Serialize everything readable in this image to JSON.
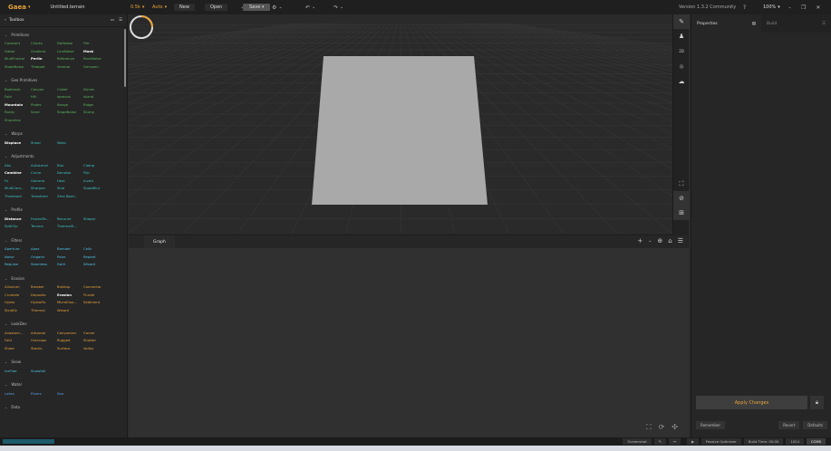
{
  "titlebar": {
    "app_name": "Gaea",
    "file_name": "Untitled.terrain",
    "resolution": "0.5k",
    "mode": "Auto",
    "new_label": "New",
    "open_label": "Open",
    "save_label": "Save",
    "version": "Version 1.3.2 Community",
    "zoom": "100%"
  },
  "toolbox": {
    "title": "Toolbox",
    "categories": [
      {
        "name": "Primitives",
        "color": "green",
        "items": [
          "Constant",
          "Cracks",
          "DotNoise",
          "File",
          "Gabor",
          "Gradient",
          "LineNoise",
          "Mask",
          "MultiFractal",
          "Perlin",
          "Reference",
          "RockNoise",
          "SlopeNoise",
          "Thebpet",
          "Voronoi",
          "Gensoen"
        ],
        "highlight": [
          "Mask",
          "Perlin"
        ]
      },
      {
        "name": "Geo Primitives",
        "color": "green",
        "items": [
          "Badlands",
          "Canyon",
          "Crater",
          "Dunes",
          "Fold",
          "Hill",
          "Igneous",
          "Island",
          "Mountain",
          "Plates",
          "Range",
          "Ridge",
          "Rocky",
          "Sand",
          "SlopeNoise",
          "Slump",
          "Shoreline"
        ],
        "highlight": [
          "Mountain"
        ]
      },
      {
        "name": "Warps",
        "color": "teal",
        "items": [
          "Displace",
          "Shear",
          "Warp"
        ],
        "highlight": [
          "Displace"
        ]
      },
      {
        "name": "Adjustments",
        "color": "teal",
        "items": [
          "Abs",
          "AutoLevel",
          "Blur",
          "Clamp",
          "Combine",
          "Curve",
          "Denoise",
          "Flip",
          "Fx",
          "Gamma",
          "Heal",
          "Invert",
          "MultiCom...",
          "Sharpen",
          "Sine",
          "SlopeBlur",
          "Threshold",
          "Transform",
          "Zero Bord..."
        ],
        "highlight": [
          "Combine"
        ]
      },
      {
        "name": "Profile",
        "color": "teal",
        "items": [
          "Distance",
          "FractalTe...",
          "Recurve",
          "Shaper",
          "SoftClip",
          "Terrace",
          "ThermalS..."
        ],
        "highlight": [
          "Distance"
        ]
      },
      {
        "name": "Filters",
        "color": "cyan",
        "items": [
          "Aperture",
          "Apex",
          "Bomber",
          "Cells",
          "Noise",
          "Origami",
          "Polar",
          "Repeat",
          "Repulse",
          "Seamless",
          "Swirl",
          "Wizard"
        ],
        "highlight": []
      },
      {
        "name": "Erosion",
        "color": "orange",
        "items": [
          "Alluvium",
          "Breaker",
          "Buildup",
          "Connector",
          "Crumble",
          "Deposits",
          "Erosion",
          "Fluvial",
          "Hydro",
          "HydroFix",
          "MicroEros...",
          "Sediment",
          "Stratify",
          "Thermal",
          "Wizard"
        ],
        "highlight": [
          "Erosion"
        ]
      },
      {
        "name": "LookDev",
        "color": "orange",
        "items": [
          "Anastom...",
          "Arboreal",
          "Canyonizer",
          "Carver",
          "Fold",
          "Outcrops",
          "Rugged",
          "Shatter",
          "Shear",
          "Stacks",
          "Surface",
          "Valley"
        ],
        "highlight": []
      },
      {
        "name": "Snow",
        "color": "cyan",
        "items": [
          "IceFloe",
          "Snowfall"
        ],
        "highlight": []
      },
      {
        "name": "Water",
        "color": "blue",
        "items": [
          "Lakes",
          "Rivers",
          "Sea"
        ],
        "highlight": []
      },
      {
        "name": "Data",
        "color": "blue",
        "items": [],
        "highlight": []
      }
    ]
  },
  "viewport": {
    "tool_label_2d": "2D"
  },
  "graph": {
    "tab_label": "Graph"
  },
  "properties": {
    "tab_properties": "Properties",
    "tab_build": "Build",
    "apply_label": "Apply Changes",
    "remember_label": "Remember",
    "revert_label": "Revert",
    "defaults_label": "Defaults"
  },
  "statusbar": {
    "screenshot": "Screenshot",
    "passive_optimizer": "Passive Optimizer",
    "build_time": "Build Time: 00:00",
    "resolution": "1024",
    "mode": "CCMS"
  },
  "colors": {
    "accent": "#e8a33c",
    "green": "#5cb85c",
    "teal": "#3ec4c4",
    "cyan": "#4dc3e6",
    "orange": "#e8a33c",
    "blue": "#5aa0e6"
  }
}
